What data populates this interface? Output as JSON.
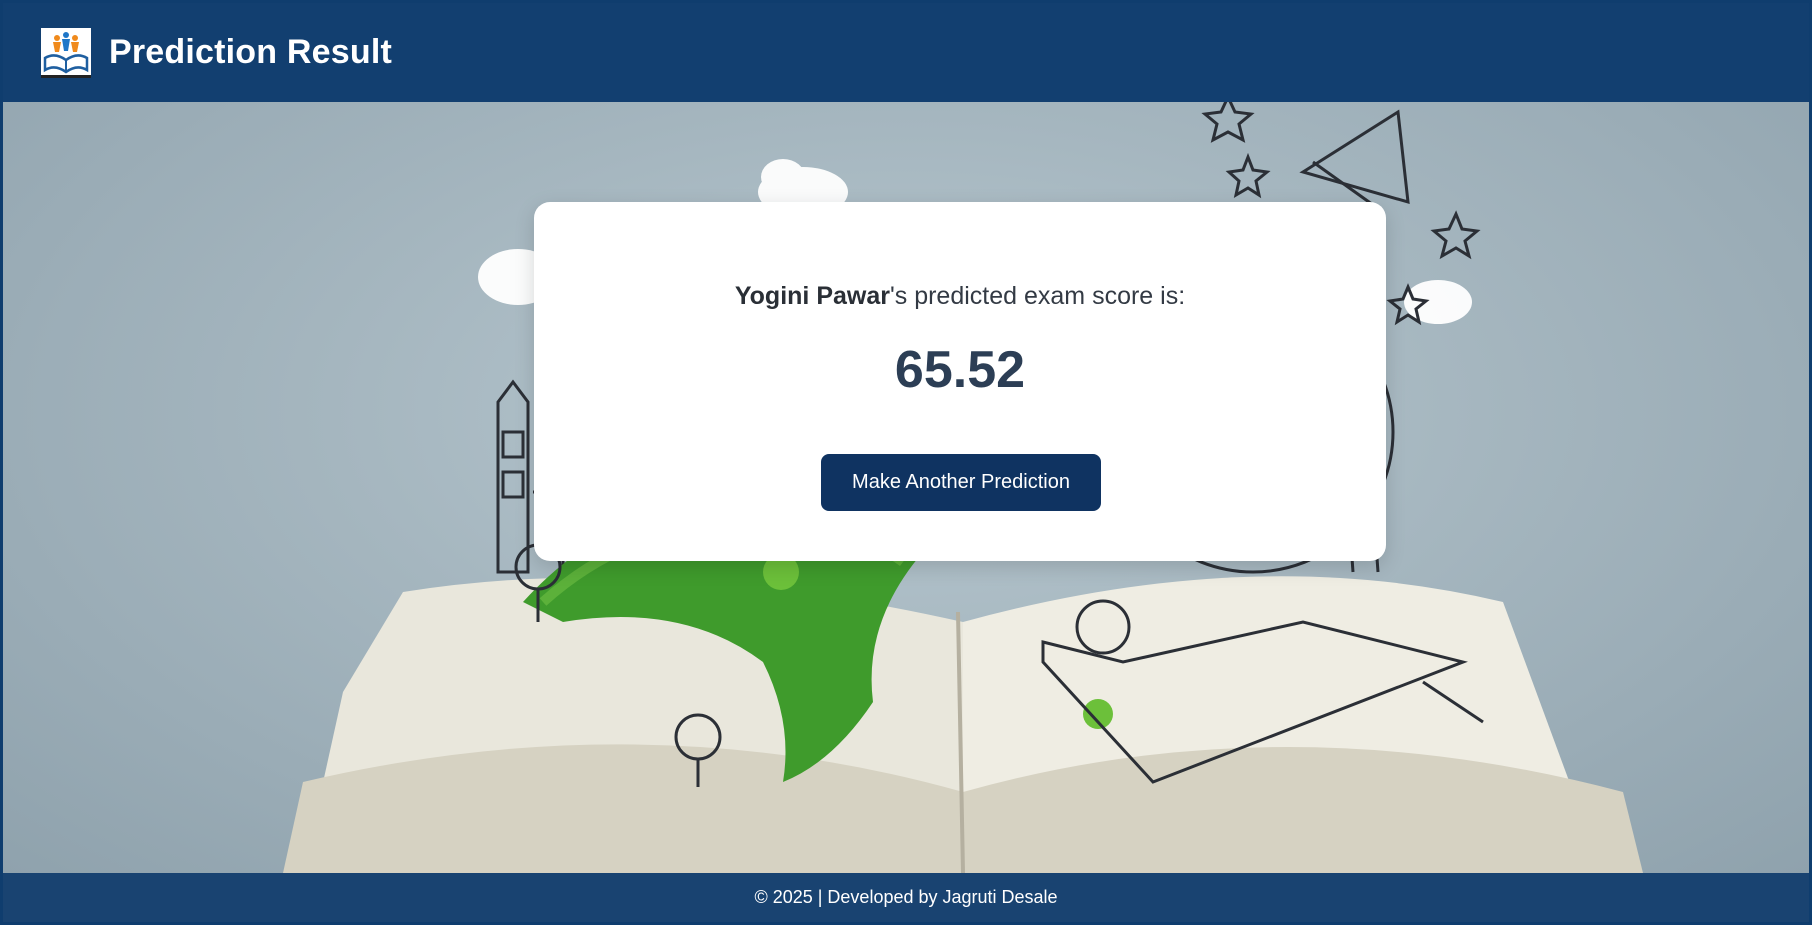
{
  "header": {
    "title": "Prediction Result",
    "logo_icon": "open-book-students-logo"
  },
  "result": {
    "student_name": "Yogini Pawar",
    "suffix_text": "'s predicted exam score is:",
    "score": "65.52"
  },
  "actions": {
    "again_label": "Make Another Prediction"
  },
  "footer": {
    "text": "© 2025 | Developed by Jagruti Desale"
  },
  "colors": {
    "header_bg": "#123f70",
    "button_bg": "#0f3361",
    "score_color": "#2c3e55"
  }
}
